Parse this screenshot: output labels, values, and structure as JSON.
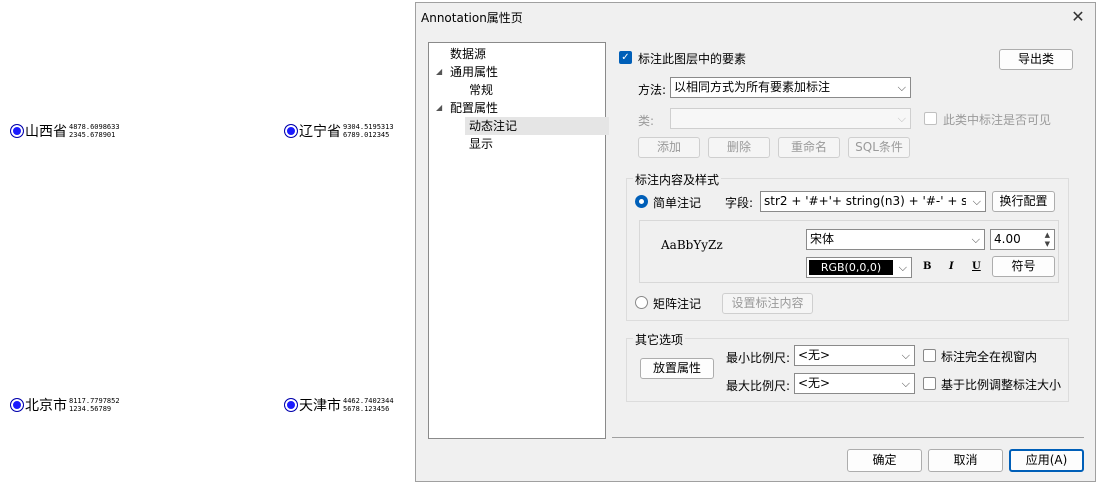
{
  "markers": [
    {
      "name": "山西省",
      "v1": "4878.6098633",
      "v2": "2345.678901"
    },
    {
      "name": "辽宁省",
      "v1": "9304.5195313",
      "v2": "6789.012345"
    },
    {
      "name": "北京市",
      "v1": "8117.7797852",
      "v2": "1234.56789"
    },
    {
      "name": "天津市",
      "v1": "4462.7402344",
      "v2": "5678.123456"
    }
  ],
  "dialog": {
    "title": "Annotation属性页",
    "close_icon": "close-icon"
  },
  "tree": {
    "items": [
      {
        "label": "数据源"
      },
      {
        "label": "通用属性"
      },
      {
        "label": "常规"
      },
      {
        "label": "配置属性"
      },
      {
        "label": "动态注记"
      },
      {
        "label": "显示"
      }
    ]
  },
  "main": {
    "label_features": "标注此图层中的要素",
    "export_class": "导出类",
    "method_label": "方法:",
    "method_value": "以相同方式为所有要素加标注",
    "class_label": "类:",
    "class_value": "",
    "class_visible": "此类中标注是否可见",
    "btn_add": "添加",
    "btn_delete": "删除",
    "btn_rename": "重命名",
    "btn_sql": "SQL条件"
  },
  "style_group": {
    "title": "标注内容及样式",
    "simple": "简单注记",
    "field_label": "字段:",
    "field_value": "str2 + '#+'+ string(n3) + '#-' + string",
    "wrap_config": "换行配置",
    "preview": "AaBbYyZz",
    "font": "宋体",
    "size": "4.00",
    "color": "RGB(0,0,0)",
    "bold": "B",
    "italic": "I",
    "underline": "U",
    "symbol": "符号",
    "matrix": "矩阵注记",
    "set_content": "设置标注内容"
  },
  "other_group": {
    "title": "其它选项",
    "placement": "放置属性",
    "min_scale_label": "最小比例尺:",
    "min_scale": "<无>",
    "max_scale_label": "最大比例尺:",
    "max_scale": "<无>",
    "in_view": "标注完全在视窗内",
    "scale_adjust": "基于比例调整标注大小"
  },
  "footer": {
    "ok": "确定",
    "cancel": "取消",
    "apply": "应用(A)"
  },
  "colors": {
    "accent": "#005fb8",
    "marker": "#1a1aff"
  }
}
